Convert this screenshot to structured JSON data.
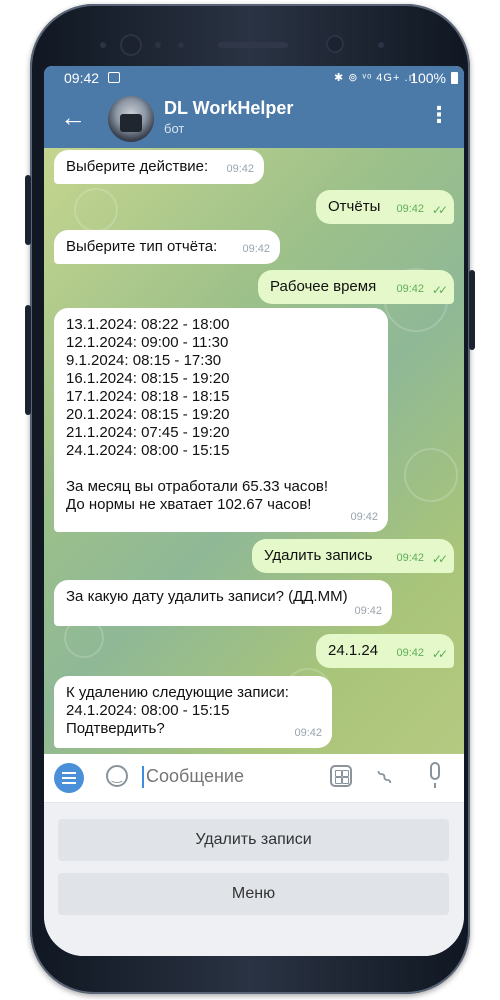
{
  "status_bar": {
    "time": "09:42",
    "icons": "✱ ⊚ ᵛᵒ 4G+ .ıl",
    "battery": "100%"
  },
  "header": {
    "title": "DL WorkHelper",
    "subtitle": "бот",
    "back_icon": "arrow-left-icon",
    "menu_icon": "more-vert-icon"
  },
  "messages": [
    {
      "dir": "in",
      "text": "Выберите действие:",
      "time": "09:42"
    },
    {
      "dir": "out",
      "text": "Отчёты",
      "time": "09:42",
      "status": "✓✓"
    },
    {
      "dir": "in",
      "text": "Выберите тип отчёта:",
      "time": "09:42"
    },
    {
      "dir": "out",
      "text": "Рабочее время",
      "time": "09:42",
      "status": "✓✓"
    },
    {
      "dir": "in",
      "text": "13.1.2024: 08:22 - 18:00\n12.1.2024: 09:00 - 11:30\n9.1.2024: 08:15 - 17:30\n16.1.2024: 08:15 - 19:20\n17.1.2024: 08:18 - 18:15\n20.1.2024: 08:15 - 19:20\n21.1.2024: 07:45 - 19:20\n24.1.2024: 08:00 - 15:15\n\nЗа месяц вы отработали 65.33 часов!\nДо нормы не хватает 102.67 часов!",
      "time": "09:42"
    },
    {
      "dir": "out",
      "text": "Удалить запись",
      "time": "09:42",
      "status": "✓✓"
    },
    {
      "dir": "in",
      "text": "За какую дату удалить записи? (ДД.ММ)",
      "time": "09:42"
    },
    {
      "dir": "out",
      "text": "24.1.24",
      "time": "09:42",
      "status": "✓✓"
    },
    {
      "dir": "in",
      "text": "К удалению следующие записи:\n24.1.2024: 08:00 - 15:15\nПодтвердить?",
      "time": "09:42"
    }
  ],
  "input": {
    "placeholder": "Сообщение"
  },
  "reply_keyboard": [
    "Удалить записи",
    "Меню"
  ]
}
